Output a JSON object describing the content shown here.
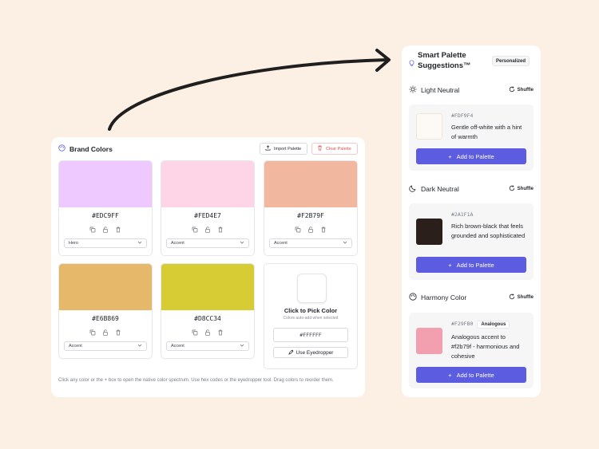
{
  "brand_panel": {
    "title": "Brand Colors",
    "import_label": "Import Palette",
    "clear_label": "Clear Palette",
    "colors": [
      {
        "hex": "#EDC9FF",
        "role": "Hero"
      },
      {
        "hex": "#FED4E7",
        "role": "Accent"
      },
      {
        "hex": "#F2B79F",
        "role": "Accent"
      },
      {
        "hex": "#E6B869",
        "role": "Accent"
      },
      {
        "hex": "#D8CC34",
        "role": "Accent"
      }
    ],
    "picker": {
      "title": "Click to Pick Color",
      "subtitle": "Colors auto-add when selected",
      "value": "#FFFFFF",
      "eyedropper_label": "Use Eyedropper"
    },
    "footer": "Click any color or the + box to open the native color spectrum. Use hex codes or the eyedropper tool. Drag colors to reorder them."
  },
  "smart_panel": {
    "title": "Smart Palette Suggestions™",
    "badge": "Personalized",
    "sections": [
      {
        "label": "Light Neutral",
        "shuffle": "Shuffle",
        "hex": "#FDF9F4",
        "desc": "Gentle off-white with a hint of warmth",
        "tag": "",
        "add": "Add to Palette"
      },
      {
        "label": "Dark Neutral",
        "shuffle": "Shuffle",
        "hex": "#2A1F1A",
        "desc": "Rich brown-black that feels grounded and sophisticated",
        "tag": "",
        "add": "Add to Palette"
      },
      {
        "label": "Harmony Color",
        "shuffle": "Shuffle",
        "hex": "#F29FB0",
        "desc": "Analogous accent to #f2b79f - harmonious and cohesive",
        "tag": "Analogous",
        "add": "Add to Palette"
      }
    ]
  },
  "colors": {
    "accent": "#5b5ce0",
    "clear_red": "#e05555",
    "background": "#fcefe3"
  }
}
